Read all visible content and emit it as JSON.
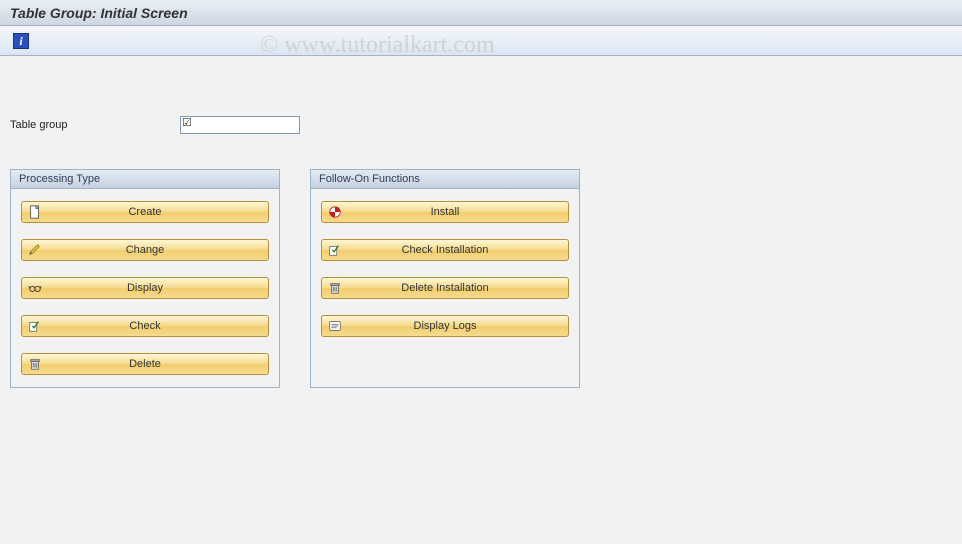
{
  "window": {
    "title": "Table Group: Initial Screen"
  },
  "watermark": "© www.tutorialkart.com",
  "toolbar": {
    "info_tooltip": "Information"
  },
  "fields": {
    "table_group": {
      "label": "Table group",
      "value": ""
    }
  },
  "panels": {
    "processing": {
      "title": "Processing Type",
      "buttons": {
        "create": "Create",
        "change": "Change",
        "display": "Display",
        "check": "Check",
        "delete": "Delete"
      }
    },
    "follow_on": {
      "title": "Follow-On Functions",
      "buttons": {
        "install": "Install",
        "check_install": "Check Installation",
        "delete_install": "Delete Installation",
        "display_logs": "Display Logs"
      }
    }
  }
}
